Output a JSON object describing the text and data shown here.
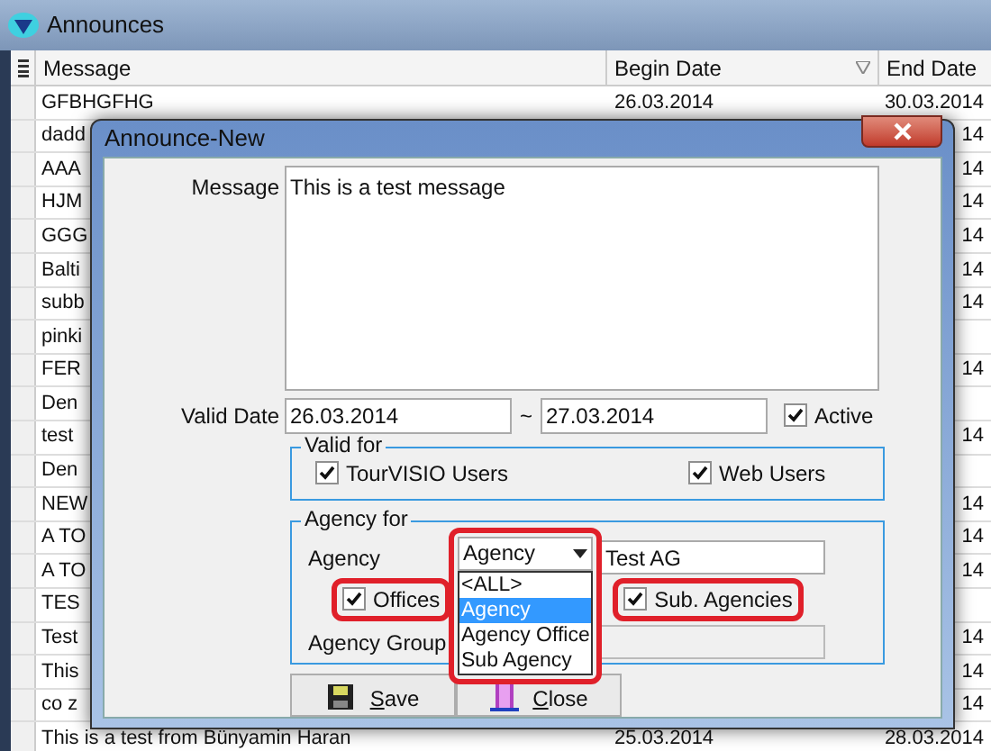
{
  "window": {
    "title": "Announces"
  },
  "table": {
    "columns": [
      {
        "label": "Message"
      },
      {
        "label": "Begin Date"
      },
      {
        "label": "End Date"
      }
    ],
    "rows": [
      {
        "message": "GFBHGFHG",
        "begin_date": "26.03.2014",
        "end_date": "30.03.2014"
      },
      {
        "message": "dadd",
        "end_date": "14"
      },
      {
        "message": "AAA",
        "end_date": "14"
      },
      {
        "message": "HJM",
        "end_date": "14"
      },
      {
        "message": "GGG",
        "end_date": "14"
      },
      {
        "message": "Balti",
        "end_date": "14"
      },
      {
        "message": "subb",
        "end_date": "14"
      },
      {
        "message": "pinki"
      },
      {
        "message": "FER",
        "end_date": "14"
      },
      {
        "message": "Den"
      },
      {
        "message": "test",
        "end_date": "14"
      },
      {
        "message": "Den"
      },
      {
        "message": "NEW",
        "end_date": "14"
      },
      {
        "message": "A TO",
        "end_date": "14"
      },
      {
        "message": "A TO",
        "end_date": "14"
      },
      {
        "message": "TES"
      },
      {
        "message": "Test",
        "end_date": "14"
      },
      {
        "message": "This",
        "end_date": "14"
      },
      {
        "message": "co z",
        "end_date": "14"
      },
      {
        "message": "This is a test from Bünyamin Haran",
        "begin_date": "25.03.2014",
        "end_date": "28.03.2014"
      }
    ]
  },
  "dialog": {
    "title": "Announce-New",
    "message_label": "Message",
    "message_value": "This is a test message",
    "valid_date_label": "Valid Date",
    "date_from": "26.03.2014",
    "tilde": "~",
    "date_to": "27.03.2014",
    "active": {
      "label": "Active",
      "checked": true
    },
    "valid_for": {
      "title": "Valid for",
      "options": [
        {
          "label": "TourVISIO Users",
          "checked": true
        },
        {
          "label": "Web Users",
          "checked": true
        }
      ]
    },
    "agency_for": {
      "title": "Agency for",
      "agency_label": "Agency",
      "agency_type": "Agency",
      "agency_value": "Test AG",
      "offices": {
        "label": "Offices",
        "checked": true
      },
      "sub_agencies": {
        "label": "Sub. Agencies",
        "checked": true
      },
      "agency_group_label": "Agency Group",
      "dropdown_items": [
        {
          "label": "<ALL>",
          "selected": false
        },
        {
          "label": "Agency",
          "selected": true
        },
        {
          "label": "Agency Office",
          "selected": false
        },
        {
          "label": "Sub Agency",
          "selected": false
        }
      ]
    },
    "buttons": [
      {
        "kind": "save",
        "label": "Save"
      },
      {
        "kind": "close",
        "label": "Close"
      }
    ]
  }
}
